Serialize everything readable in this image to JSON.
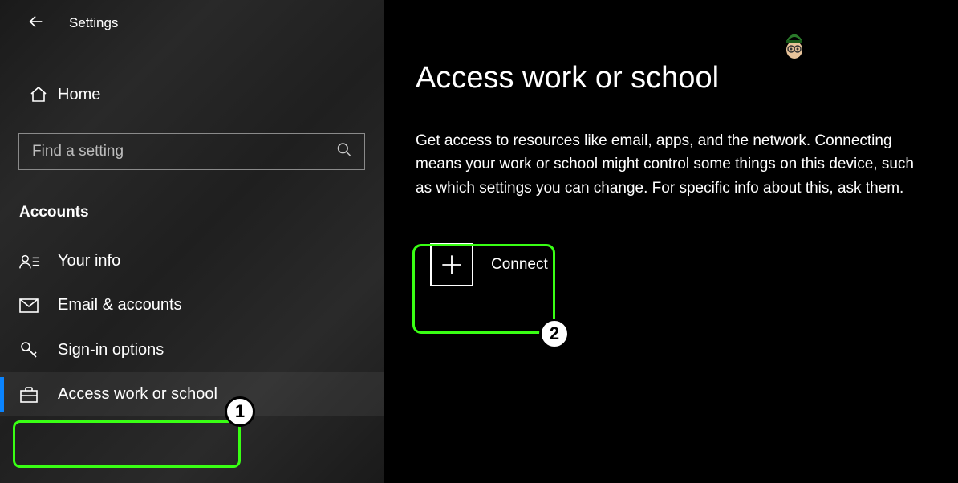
{
  "header": {
    "title": "Settings"
  },
  "home": {
    "label": "Home"
  },
  "search": {
    "placeholder": "Find a setting"
  },
  "section": {
    "title": "Accounts"
  },
  "nav": {
    "items": [
      {
        "label": "Your info"
      },
      {
        "label": "Email & accounts"
      },
      {
        "label": "Sign-in options"
      },
      {
        "label": "Access work or school"
      }
    ]
  },
  "page": {
    "title": "Access work or school",
    "description": "Get access to resources like email, apps, and the network. Connecting means your work or school might control some things on this device, such as which settings you can change. For specific info about this, ask them.",
    "connect_label": "Connect"
  },
  "annotations": {
    "badge1": "1",
    "badge2": "2"
  }
}
